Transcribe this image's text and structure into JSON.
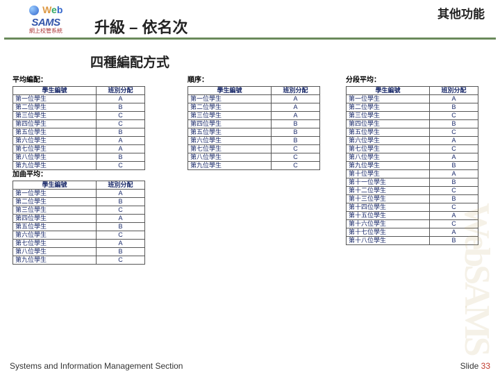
{
  "header": {
    "logo_text_web": "Web",
    "logo_text_sams": "SAMS",
    "logo_sub": "網上校管系統",
    "title": "升級 – 依名次",
    "corner": "其他功能"
  },
  "subtitle": "四種編配方式",
  "tables": {
    "avg": {
      "label": "平均編配：",
      "col1": "學生編號",
      "col2": "班別分配",
      "rows": [
        {
          "s": "第一位學生",
          "c": "A"
        },
        {
          "s": "第二位學生",
          "c": "B"
        },
        {
          "s": "第三位學生",
          "c": "C"
        },
        {
          "s": "第四位學生",
          "c": "C"
        },
        {
          "s": "第五位學生",
          "c": "B"
        },
        {
          "s": "第六位學生",
          "c": "A"
        },
        {
          "s": "第七位學生",
          "c": "A"
        },
        {
          "s": "第八位學生",
          "c": "B"
        },
        {
          "s": "第九位學生",
          "c": "C"
        }
      ]
    },
    "weighted": {
      "label": "加曲平均：",
      "col1": "學生編號",
      "col2": "班別分配",
      "rows": [
        {
          "s": "第一位學生",
          "c": "A"
        },
        {
          "s": "第二位學生",
          "c": "B"
        },
        {
          "s": "第三位學生",
          "c": "C"
        },
        {
          "s": "第四位學生",
          "c": "A"
        },
        {
          "s": "第五位學生",
          "c": "B"
        },
        {
          "s": "第六位學生",
          "c": "C"
        },
        {
          "s": "第七位學生",
          "c": "A"
        },
        {
          "s": "第八位學生",
          "c": "B"
        },
        {
          "s": "第九位學生",
          "c": "C"
        }
      ]
    },
    "order": {
      "label": "順序：",
      "col1": "學生編號",
      "col2": "班別分配",
      "rows": [
        {
          "s": "第一位學生",
          "c": "A"
        },
        {
          "s": "第二位學生",
          "c": "A"
        },
        {
          "s": "第三位學生",
          "c": "A"
        },
        {
          "s": "第四位學生",
          "c": "B"
        },
        {
          "s": "第五位學生",
          "c": "B"
        },
        {
          "s": "第六位學生",
          "c": "B"
        },
        {
          "s": "第七位學生",
          "c": "C"
        },
        {
          "s": "第八位學生",
          "c": "C"
        },
        {
          "s": "第九位學生",
          "c": "C"
        }
      ]
    },
    "segment": {
      "label": "分段平均：",
      "col1": "學生編號",
      "col2": "班別分配",
      "rows": [
        {
          "s": "第一位學生",
          "c": "A"
        },
        {
          "s": "第二位學生",
          "c": "B"
        },
        {
          "s": "第三位學生",
          "c": "C"
        },
        {
          "s": "第四位學生",
          "c": "B"
        },
        {
          "s": "第五位學生",
          "c": "C"
        },
        {
          "s": "第六位學生",
          "c": "A"
        },
        {
          "s": "第七位學生",
          "c": "C"
        },
        {
          "s": "第八位學生",
          "c": "A"
        },
        {
          "s": "第九位學生",
          "c": "B"
        },
        {
          "s": "第十位學生",
          "c": "A"
        },
        {
          "s": "第十一位學生",
          "c": "B"
        },
        {
          "s": "第十二位學生",
          "c": "C"
        },
        {
          "s": "第十三位學生",
          "c": "B"
        },
        {
          "s": "第十四位學生",
          "c": "C"
        },
        {
          "s": "第十五位學生",
          "c": "A"
        },
        {
          "s": "第十六位學生",
          "c": "C"
        },
        {
          "s": "第十七位學生",
          "c": "A"
        },
        {
          "s": "第十八位學生",
          "c": "B"
        }
      ]
    }
  },
  "footer": {
    "left": "Systems and Information Management Section",
    "slide_label": "Slide",
    "slide_num": "33"
  },
  "watermark": "WebSAMS"
}
